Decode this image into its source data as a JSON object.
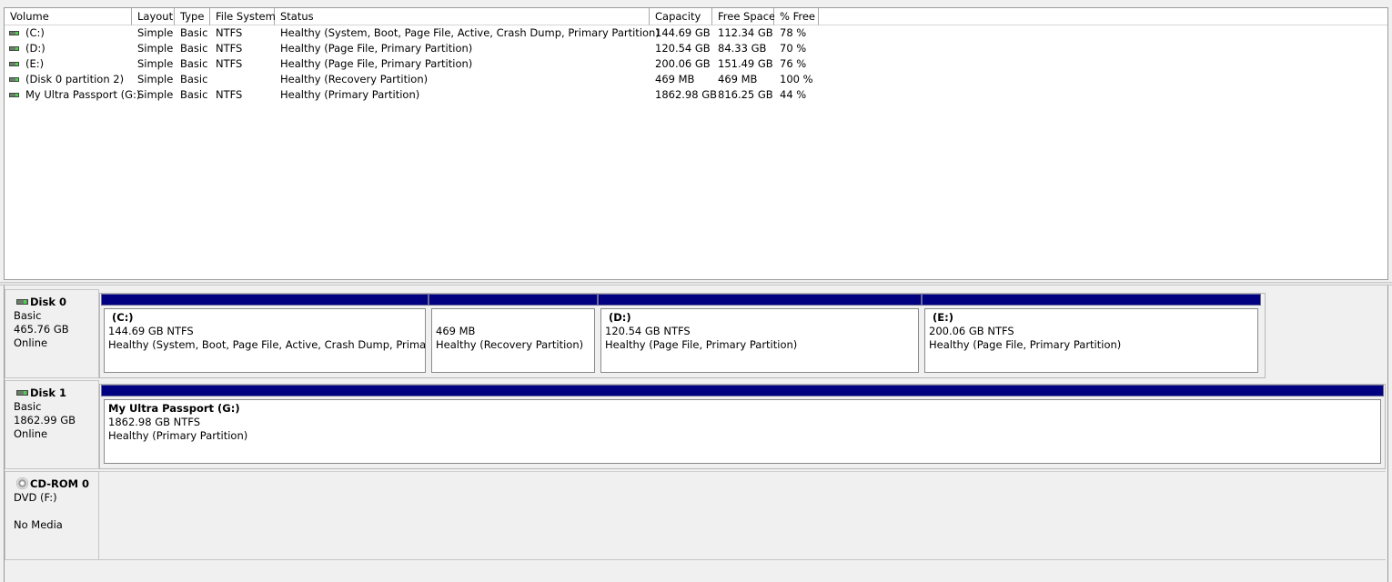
{
  "volume_list": {
    "columns": [
      "Volume",
      "Layout",
      "Type",
      "File System",
      "Status",
      "Capacity",
      "Free Space",
      "% Free"
    ],
    "rows": [
      {
        "volume": "(C:)",
        "layout": "Simple",
        "type": "Basic",
        "fs": "NTFS",
        "status": "Healthy (System, Boot, Page File, Active, Crash Dump, Primary Partition)",
        "capacity": "144.69 GB",
        "free": "112.34 GB",
        "pct": "78 %"
      },
      {
        "volume": "(D:)",
        "layout": "Simple",
        "type": "Basic",
        "fs": "NTFS",
        "status": "Healthy (Page File, Primary Partition)",
        "capacity": "120.54 GB",
        "free": "84.33 GB",
        "pct": "70 %"
      },
      {
        "volume": "(E:)",
        "layout": "Simple",
        "type": "Basic",
        "fs": "NTFS",
        "status": "Healthy (Page File, Primary Partition)",
        "capacity": "200.06 GB",
        "free": "151.49 GB",
        "pct": "76 %"
      },
      {
        "volume": "(Disk 0 partition 2)",
        "layout": "Simple",
        "type": "Basic",
        "fs": "",
        "status": "Healthy (Recovery Partition)",
        "capacity": "469 MB",
        "free": "469 MB",
        "pct": "100 %"
      },
      {
        "volume": "My Ultra Passport (G:)",
        "layout": "Simple",
        "type": "Basic",
        "fs": "NTFS",
        "status": "Healthy (Primary Partition)",
        "capacity": "1862.98 GB",
        "free": "816.25 GB",
        "pct": "44 %"
      }
    ]
  },
  "disks": [
    {
      "name": "Disk 0",
      "type": "Basic",
      "size": "465.76 GB",
      "state": "Online",
      "partitions": [
        {
          "name": "(C:)",
          "size_fs": "144.69 GB NTFS",
          "status": "Healthy (System, Boot, Page File, Active, Crash Dump, Primary Pa"
        },
        {
          "name": "",
          "size_fs": "469 MB",
          "status": "Healthy (Recovery Partition)"
        },
        {
          "name": "(D:)",
          "size_fs": "120.54 GB NTFS",
          "status": "Healthy (Page File, Primary Partition)"
        },
        {
          "name": "(E:)",
          "size_fs": "200.06 GB NTFS",
          "status": "Healthy (Page File, Primary Partition)"
        }
      ]
    },
    {
      "name": "Disk 1",
      "type": "Basic",
      "size": "1862.99 GB",
      "state": "Online",
      "partitions": [
        {
          "name": "My Ultra Passport  (G:)",
          "size_fs": "1862.98 GB NTFS",
          "status": "Healthy (Primary Partition)"
        }
      ]
    }
  ],
  "cdrom": {
    "name": "CD-ROM 0",
    "drive": "DVD (F:)",
    "media": "No Media"
  },
  "colors": {
    "partition_bar": "#000080",
    "background": "#f0f0f0"
  },
  "icons": {
    "volume": "disk-volume-icon",
    "disk": "hard-disk-icon",
    "cdrom": "cd-rom-icon"
  }
}
